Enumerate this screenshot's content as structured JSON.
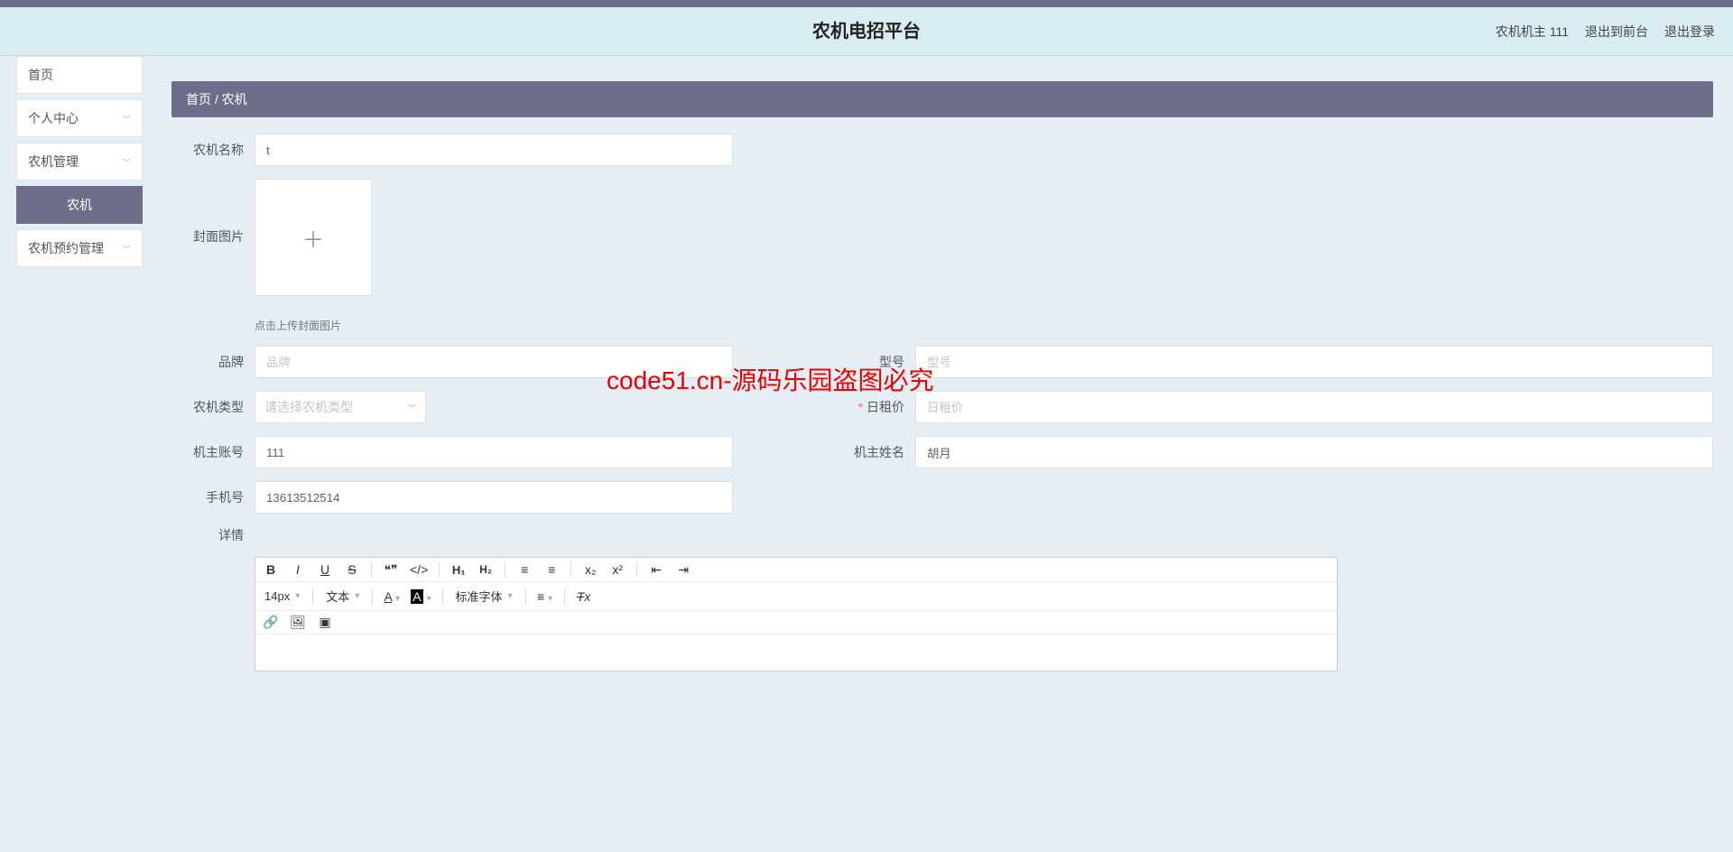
{
  "header": {
    "title": "农机电招平台",
    "user": "农机机主 111",
    "to_front": "退出到前台",
    "logout": "退出登录"
  },
  "sidebar": {
    "home": "首页",
    "profile": "个人中心",
    "machine_mgmt": "农机管理",
    "machine": "农机",
    "reserve_mgmt": "农机预约管理"
  },
  "breadcrumb": "首页 / 农机",
  "form": {
    "name_label": "农机名称",
    "name_value": "t",
    "cover_label": "封面图片",
    "upload_tip": "点击上传封面图片",
    "brand_label": "品牌",
    "brand_ph": "品牌",
    "model_label": "型号",
    "model_ph": "型号",
    "type_label": "农机类型",
    "type_ph": "请选择农机类型",
    "rent_label": "日租价",
    "rent_ph": "日租价",
    "owner_acct_label": "机主账号",
    "owner_acct_value": "111",
    "owner_name_label": "机主姓名",
    "owner_name_value": "胡月",
    "phone_label": "手机号",
    "phone_value": "13613512514",
    "detail_label": "详情"
  },
  "editor": {
    "font_size": "14px",
    "text_type": "文本",
    "font_family": "标准字体"
  },
  "watermark": "code51.cn-源码乐园盗图必究"
}
